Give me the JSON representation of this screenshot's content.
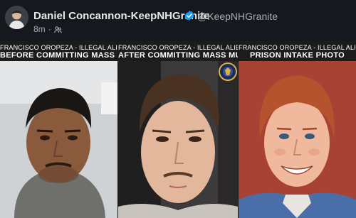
{
  "post": {
    "author_name": "Daniel Concannon-KeepNHGranite",
    "handle": "@KeepNHGranite",
    "time": "8m",
    "separator": "·"
  },
  "panels": [
    {
      "line1": "FRANCISCO OROPEZA - ILLEGAL ALIEN",
      "line2": "BEFORE COMMITTING MASS MURDER"
    },
    {
      "line1": "FRANCISCO OROPEZA - ILLEGAL ALIEN",
      "line2": "AFTER COMMITTING MASS MURDER"
    },
    {
      "line1": "FRANCISCO OROPEZA - ILLEGAL ALIEN",
      "line2": "PRISON INTAKE PHOTO"
    }
  ],
  "colors": {
    "verified": "#1d9bf0",
    "background": "#15181c"
  },
  "icons": [
    "verified-badge-icon",
    "audience-icon",
    "fbi-seal-icon"
  ]
}
